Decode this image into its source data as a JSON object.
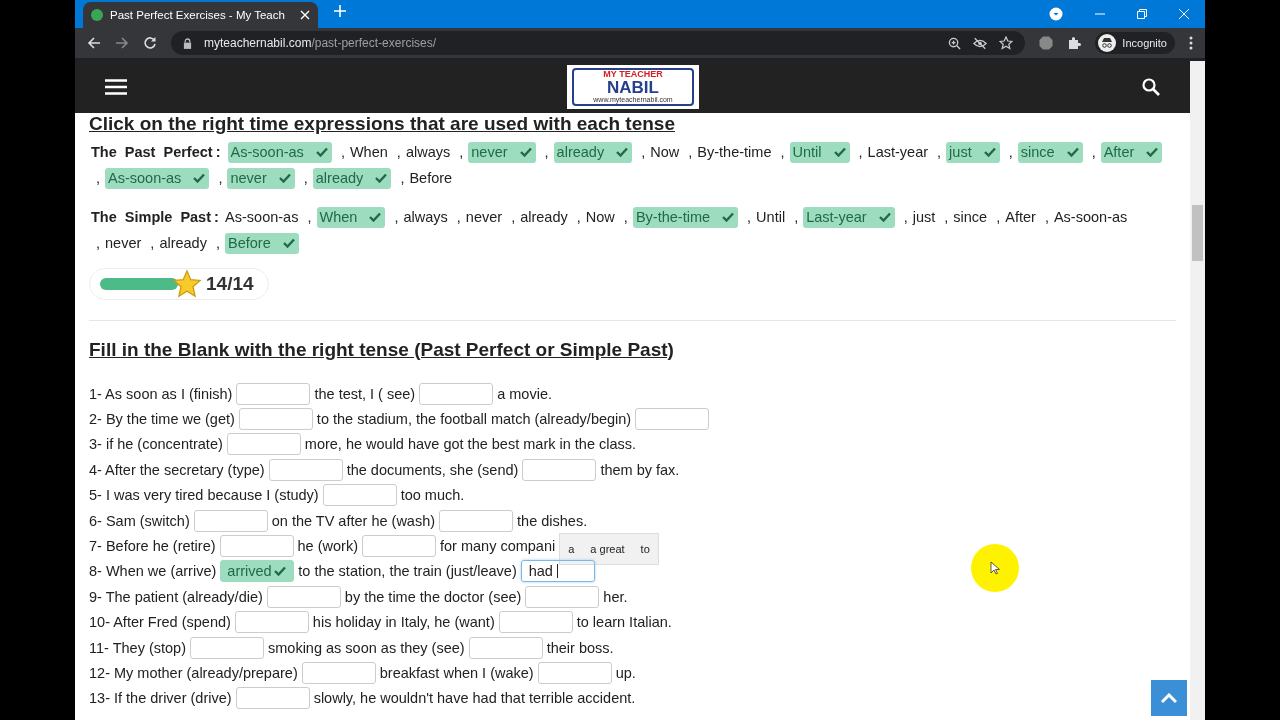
{
  "browser": {
    "tab": {
      "title": "Past Perfect Exercises - My Teach",
      "selected": true
    },
    "url": {
      "host": "myteachernabil.com",
      "path": "/past-perfect-exercises/"
    },
    "profile": "Incognito"
  },
  "header": {
    "logo": {
      "line1": "MY TEACHER",
      "line2": "NABIL",
      "line3": "www.myteachernabil.com"
    }
  },
  "section1": {
    "heading": "Click on the right time expressions that are used with each tense",
    "separator": ",",
    "groups": [
      {
        "label": "The Past Perfect",
        "colon": ":",
        "items": [
          {
            "text": "As-soon-as",
            "selected": true
          },
          {
            "text": "When",
            "selected": false
          },
          {
            "text": "always",
            "selected": false
          },
          {
            "text": "never",
            "selected": true
          },
          {
            "text": "already",
            "selected": true
          },
          {
            "text": "Now",
            "selected": false
          },
          {
            "text": "By-the-time",
            "selected": false
          },
          {
            "text": "Until",
            "selected": true
          },
          {
            "text": "Last-year",
            "selected": false
          },
          {
            "text": "just",
            "selected": true
          },
          {
            "text": "since",
            "selected": true
          },
          {
            "text": "After",
            "selected": true
          },
          {
            "text": "As-soon-as",
            "selected": true
          },
          {
            "text": "never",
            "selected": true
          },
          {
            "text": "already",
            "selected": true
          },
          {
            "text": "Before",
            "selected": false
          }
        ]
      },
      {
        "label": "The Simple Past",
        "colon": ":",
        "items": [
          {
            "text": "As-soon-as",
            "selected": false
          },
          {
            "text": "When",
            "selected": true
          },
          {
            "text": "always",
            "selected": false
          },
          {
            "text": "never",
            "selected": false
          },
          {
            "text": "already",
            "selected": false
          },
          {
            "text": "Now",
            "selected": false
          },
          {
            "text": "By-the-time",
            "selected": true
          },
          {
            "text": "Until",
            "selected": false
          },
          {
            "text": "Last-year",
            "selected": true
          },
          {
            "text": "just",
            "selected": false
          },
          {
            "text": "since",
            "selected": false
          },
          {
            "text": "After",
            "selected": false
          },
          {
            "text": "As-soon-as",
            "selected": false
          },
          {
            "text": "never",
            "selected": false
          },
          {
            "text": "already",
            "selected": false
          },
          {
            "text": "Before",
            "selected": true
          }
        ]
      }
    ],
    "score": {
      "level": 1.0,
      "text": "14/14"
    }
  },
  "section2": {
    "heading": "Fill in the Blank with the right tense (Past Perfect or Simple Past)",
    "sentences": [
      [
        {
          "kind": "text",
          "text": "1- As soon as I (finish)"
        },
        {
          "kind": "blank"
        },
        {
          "kind": "text",
          "text": "the test, I ( see)"
        },
        {
          "kind": "blank"
        },
        {
          "kind": "text",
          "text": "a movie."
        }
      ],
      [
        {
          "kind": "text",
          "text": "2- By the time we (get)"
        },
        {
          "kind": "blank"
        },
        {
          "kind": "text",
          "text": "to the stadium, the football match (already/begin)"
        },
        {
          "kind": "blank"
        }
      ],
      [
        {
          "kind": "text",
          "text": "3- if he (concentrate)"
        },
        {
          "kind": "blank"
        },
        {
          "kind": "text",
          "text": "more, he would have got the best mark in the class."
        }
      ],
      [
        {
          "kind": "text",
          "text": "4- After the secretary (type)"
        },
        {
          "kind": "blank"
        },
        {
          "kind": "text",
          "text": "the documents, she (send)"
        },
        {
          "kind": "blank"
        },
        {
          "kind": "text",
          "text": "them by fax."
        }
      ],
      [
        {
          "kind": "text",
          "text": "5- I was very tired because I (study)"
        },
        {
          "kind": "blank"
        },
        {
          "kind": "text",
          "text": "too much."
        }
      ],
      [
        {
          "kind": "text",
          "text": "6- Sam (switch)"
        },
        {
          "kind": "blank"
        },
        {
          "kind": "text",
          "text": "on the TV after he (wash)"
        },
        {
          "kind": "blank"
        },
        {
          "kind": "text",
          "text": "the dishes."
        }
      ],
      [
        {
          "kind": "text",
          "text": "7- Before he (retire)"
        },
        {
          "kind": "blank"
        },
        {
          "kind": "text",
          "text": "he (work)"
        },
        {
          "kind": "blank"
        },
        {
          "kind": "text",
          "text": "for many compani"
        }
      ],
      [
        {
          "kind": "text",
          "text": "8- When we (arrive)"
        },
        {
          "kind": "blank",
          "value": "arrived",
          "correct": true
        },
        {
          "kind": "text",
          "text": "to the station, the train (just/leave)"
        },
        {
          "kind": "blank",
          "value": "had",
          "focused": true
        }
      ],
      [
        {
          "kind": "text",
          "text": "9- The patient (already/die)"
        },
        {
          "kind": "blank"
        },
        {
          "kind": "text",
          "text": "by the time the doctor (see)"
        },
        {
          "kind": "blank"
        },
        {
          "kind": "text",
          "text": "her."
        }
      ],
      [
        {
          "kind": "text",
          "text": "10- After Fred (spend)"
        },
        {
          "kind": "blank"
        },
        {
          "kind": "text",
          "text": "his holiday in Italy, he (want)"
        },
        {
          "kind": "blank"
        },
        {
          "kind": "text",
          "text": "to learn Italian."
        }
      ],
      [
        {
          "kind": "text",
          "text": "11- They (stop)"
        },
        {
          "kind": "blank"
        },
        {
          "kind": "text",
          "text": "smoking as soon as they (see)"
        },
        {
          "kind": "blank"
        },
        {
          "kind": "text",
          "text": "their boss."
        }
      ],
      [
        {
          "kind": "text",
          "text": "12- My mother (already/prepare)"
        },
        {
          "kind": "blank"
        },
        {
          "kind": "text",
          "text": "breakfast when I (wake)"
        },
        {
          "kind": "blank"
        },
        {
          "kind": "text",
          "text": "up."
        }
      ],
      [
        {
          "kind": "text",
          "text": "13- If the driver (drive)"
        },
        {
          "kind": "blank"
        },
        {
          "kind": "text",
          "text": "slowly, he wouldn't have had that terrible accident."
        }
      ]
    ],
    "suggestions": [
      "a",
      "a great",
      "to"
    ]
  }
}
